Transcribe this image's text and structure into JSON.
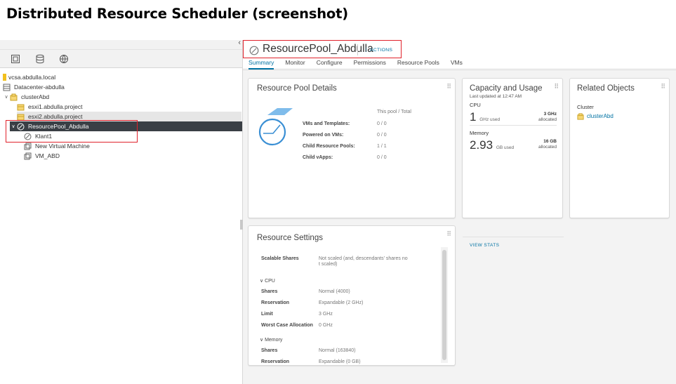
{
  "slide_title": "Distributed Resource Scheduler (screenshot)",
  "navigator": {
    "tree": [
      {
        "label": "vcsa.abdulla.local",
        "icon": "vcenter-icon"
      },
      {
        "label": "Datacenter-abdulla",
        "icon": "datacenter-icon"
      },
      {
        "label": "clusterAbd",
        "icon": "cluster-icon"
      },
      {
        "label": "esxi1.abdulla.project",
        "icon": "host-icon"
      },
      {
        "label": "esxi2.abdulla.project",
        "icon": "host-icon"
      },
      {
        "label": "ResourcePool_Abdulla",
        "icon": "resource-pool-icon"
      },
      {
        "label": "Klant1",
        "icon": "resource-pool-icon"
      },
      {
        "label": "New Virtual Machine",
        "icon": "vm-icon"
      },
      {
        "label": "VM_ABD",
        "icon": "vm-icon"
      }
    ]
  },
  "header": {
    "title": "ResourcePool_Abdulla",
    "actions_label": "ACTIONS",
    "tabs": [
      "Summary",
      "Monitor",
      "Configure",
      "Permissions",
      "Resource Pools",
      "VMs"
    ]
  },
  "details": {
    "title": "Resource Pool Details",
    "column_header": "This pool / Total",
    "rows": [
      {
        "label": "VMs and Templates:",
        "value": "0 / 0"
      },
      {
        "label": "Powered on VMs:",
        "value": "0 / 0"
      },
      {
        "label": "Child Resource Pools:",
        "value": "1 / 1"
      },
      {
        "label": "Child vApps:",
        "value": "0 / 0"
      }
    ]
  },
  "capacity": {
    "title": "Capacity and Usage",
    "updated": "Last updated at 12:47 AM",
    "cpu": {
      "section": "CPU",
      "used_value": "1",
      "used_unit": "GHz used",
      "alloc_value": "3 GHz",
      "alloc_label": "allocated"
    },
    "memory": {
      "section": "Memory",
      "used_value": "2.93",
      "used_unit": "GB used",
      "alloc_value": "16 GB",
      "alloc_label": "allocated"
    },
    "view_stats": "VIEW STATS"
  },
  "related": {
    "title": "Related Objects",
    "section": "Cluster",
    "link": "clusterAbd"
  },
  "settings": {
    "title": "Resource Settings",
    "scalable_label": "Scalable Shares",
    "scalable_value_1": "Not scaled (and, descendants' shares no",
    "scalable_value_2": "t scaled)",
    "cpu_section": "CPU",
    "cpu_rows": [
      {
        "label": "Shares",
        "value": "Normal (4000)"
      },
      {
        "label": "Reservation",
        "value": "Expandable (2 GHz)"
      },
      {
        "label": "Limit",
        "value": "3 GHz"
      },
      {
        "label": "Worst Case Allocation",
        "value": "0 GHz"
      }
    ],
    "memory_section": "Memory",
    "memory_rows": [
      {
        "label": "Shares",
        "value": "Normal (163840)"
      },
      {
        "label": "Reservation",
        "value": "Expandable (0 GB)"
      }
    ]
  },
  "colors": {
    "accent": "#0072a3",
    "highlight_box": "#e0222b",
    "selected_row": "#3a3f45"
  }
}
